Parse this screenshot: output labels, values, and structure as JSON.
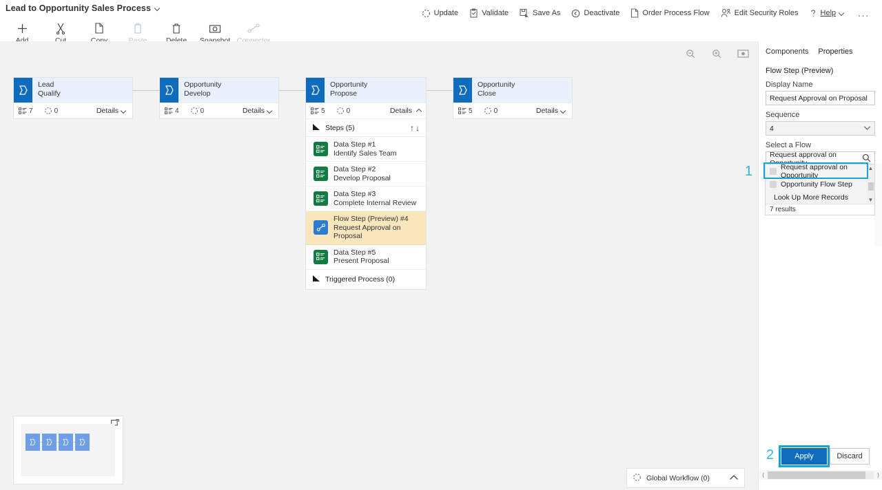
{
  "window": {
    "title": "Lead to Opportunity Sales Process",
    "title_chevron_icon": "chevron-down-icon"
  },
  "toolbar_left": [
    {
      "label": "Add",
      "icon": "plus-icon",
      "disabled": false
    },
    {
      "label": "Cut",
      "icon": "scissors-icon",
      "disabled": false
    },
    {
      "label": "Copy",
      "icon": "copy-icon",
      "disabled": false
    },
    {
      "label": "Paste",
      "icon": "paste-icon",
      "disabled": true
    },
    {
      "label": "Delete",
      "icon": "trash-icon",
      "disabled": false
    },
    {
      "label": "Snapshot",
      "icon": "camera-icon",
      "disabled": false
    },
    {
      "label": "Connector",
      "icon": "connector-icon",
      "disabled": true
    }
  ],
  "toolbar_right": [
    {
      "label": "Update",
      "icon": "refresh-spinner-icon"
    },
    {
      "label": "Validate",
      "icon": "clipboard-check-icon"
    },
    {
      "label": "Save As",
      "icon": "save-as-icon"
    },
    {
      "label": "Deactivate",
      "icon": "deactivate-clock-icon"
    },
    {
      "label": "Order Process Flow",
      "icon": "page-icon"
    },
    {
      "label": "Edit Security Roles",
      "icon": "security-roles-icon"
    },
    {
      "label": "Help",
      "icon": "question-icon",
      "chevron": true
    },
    {
      "label": "...",
      "icon": "overflow-ellipsis-icon"
    }
  ],
  "canvas": {
    "zoom_controls": [
      {
        "name": "zoom-out-icon",
        "label": "Zoom out"
      },
      {
        "name": "zoom-in-icon",
        "label": "Zoom in"
      },
      {
        "name": "fit-to-screen-icon",
        "label": "Fit to screen"
      }
    ],
    "stages": [
      {
        "entity": "Lead",
        "stage_name": "Qualify",
        "steps_count": "7",
        "triggered_count": "0",
        "details_label": "Details",
        "expanded": false,
        "badge_icon": "stage-flag-icon"
      },
      {
        "entity": "Opportunity",
        "stage_name": "Develop",
        "steps_count": "4",
        "triggered_count": "0",
        "details_label": "Details",
        "expanded": false,
        "badge_icon": "stage-flag-icon"
      },
      {
        "entity": "Opportunity",
        "stage_name": "Propose",
        "steps_count": "5",
        "triggered_count": "0",
        "details_label": "Details",
        "expanded": true,
        "badge_icon": "stage-flag-icon",
        "steps_header": "Steps (5)",
        "triggered_header": "Triggered Process (0)",
        "steps": [
          {
            "line1": "Data Step #1",
            "line2": "Identify Sales Team",
            "kind": "data",
            "icon": "data-step-icon",
            "selected": false
          },
          {
            "line1": "Data Step #2",
            "line2": "Develop Proposal",
            "kind": "data",
            "icon": "data-step-icon",
            "selected": false
          },
          {
            "line1": "Data Step #3",
            "line2": "Complete Internal Review",
            "kind": "data",
            "icon": "data-step-icon",
            "selected": false
          },
          {
            "line1": "Flow Step (Preview) #4",
            "line2": "Request Approval on Proposal",
            "kind": "flow",
            "icon": "flow-step-icon",
            "selected": true
          },
          {
            "line1": "Data Step #5",
            "line2": "Present Proposal",
            "kind": "data",
            "icon": "data-step-icon",
            "selected": false
          }
        ]
      },
      {
        "entity": "Opportunity",
        "stage_name": "Close",
        "steps_count": "5",
        "triggered_count": "0",
        "details_label": "Details",
        "expanded": false,
        "badge_icon": "stage-flag-icon"
      }
    ],
    "minimap": {
      "expand_icon": "minimap-expand-icon",
      "node_count": 4,
      "node_icon": "stage-flag-icon"
    },
    "global_workflow": {
      "label": "Global Workflow (0)",
      "icon": "spinner-icon",
      "chevron_icon": "chevron-up-icon"
    }
  },
  "properties_panel": {
    "tabs": [
      {
        "label": "Components",
        "active": false
      },
      {
        "label": "Properties",
        "active": true
      }
    ],
    "subtitle": "Flow Step (Preview)",
    "display_name": {
      "label": "Display Name",
      "value": "Request Approval on Proposal"
    },
    "sequence": {
      "label": "Sequence",
      "value": "4",
      "caret_icon": "chevron-down-icon"
    },
    "select_a_flow": {
      "label": "Select a Flow",
      "value": "Request approval on Opportunity",
      "search_icon": "search-icon"
    },
    "dropdown": {
      "items": [
        {
          "label": "Request approval on Opportunity",
          "has_thumb": true,
          "highlighted": true
        },
        {
          "label": "Opportunity Flow Step",
          "has_thumb": true,
          "highlighted": false
        },
        {
          "label": "Look Up More Records",
          "has_thumb": false,
          "highlighted": false
        }
      ],
      "results_text": "7 results",
      "scroll_up_icon": "chevron-up-icon",
      "scroll_down_icon": "chevron-down-icon"
    },
    "footer": {
      "apply_label": "Apply",
      "discard_label": "Discard"
    },
    "hscroll": {
      "left_icon": "chevron-left-icon",
      "right_icon": "chevron-right-icon"
    }
  },
  "annotations": [
    {
      "number": "1",
      "target": "flow-dropdown-first-item"
    },
    {
      "number": "2",
      "target": "apply-button"
    }
  ],
  "colors": {
    "accent_blue": "#0f6cbd",
    "annotation_cyan": "#2eb4e0",
    "stage_header_bg": "#e9f1fd",
    "selected_step_bg": "#fae6bd",
    "data_step_green": "#107c41",
    "flow_step_blue": "#2b7cd3",
    "canvas_bg": "#f2f2f2"
  }
}
